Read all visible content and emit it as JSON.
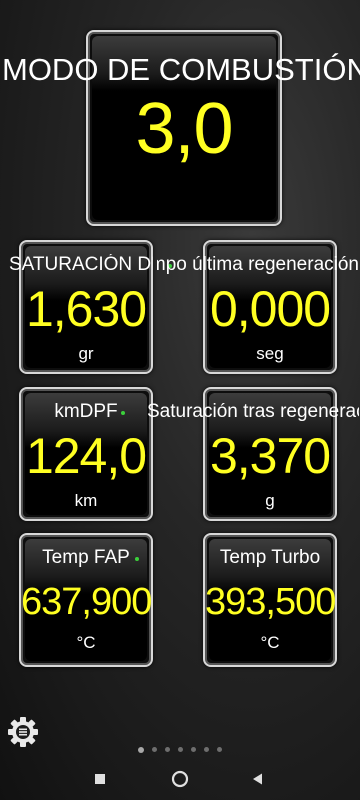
{
  "main_gauge": {
    "label": "MODO DE COMBUSTIÓN",
    "value": "3,0"
  },
  "gauges": [
    {
      "label": "SATURACIÓN DPF",
      "value": "1,630",
      "unit": "gr"
    },
    {
      "label": "Tiempo última regeneración",
      "value": "0,000",
      "unit": "seg"
    },
    {
      "label": "kmDPF",
      "value": "124,0",
      "unit": "km"
    },
    {
      "label": "Saturación tras regeneración",
      "value": "3,370",
      "unit": "g"
    },
    {
      "label": "Temp FAP",
      "value": "637,900",
      "unit": "°C"
    },
    {
      "label": "Temp Turbo",
      "value": "393,500",
      "unit": "°C"
    }
  ],
  "settings_icon": "gear-menu-icon",
  "pager": {
    "total": 7,
    "active_index": 0
  },
  "navbar": {
    "icons": [
      "recent-apps-icon",
      "home-icon",
      "back-icon"
    ]
  },
  "colors": {
    "value_text": "#ffff22",
    "label_text": "#ffffff",
    "indicator_dot": "#3bd13b"
  }
}
